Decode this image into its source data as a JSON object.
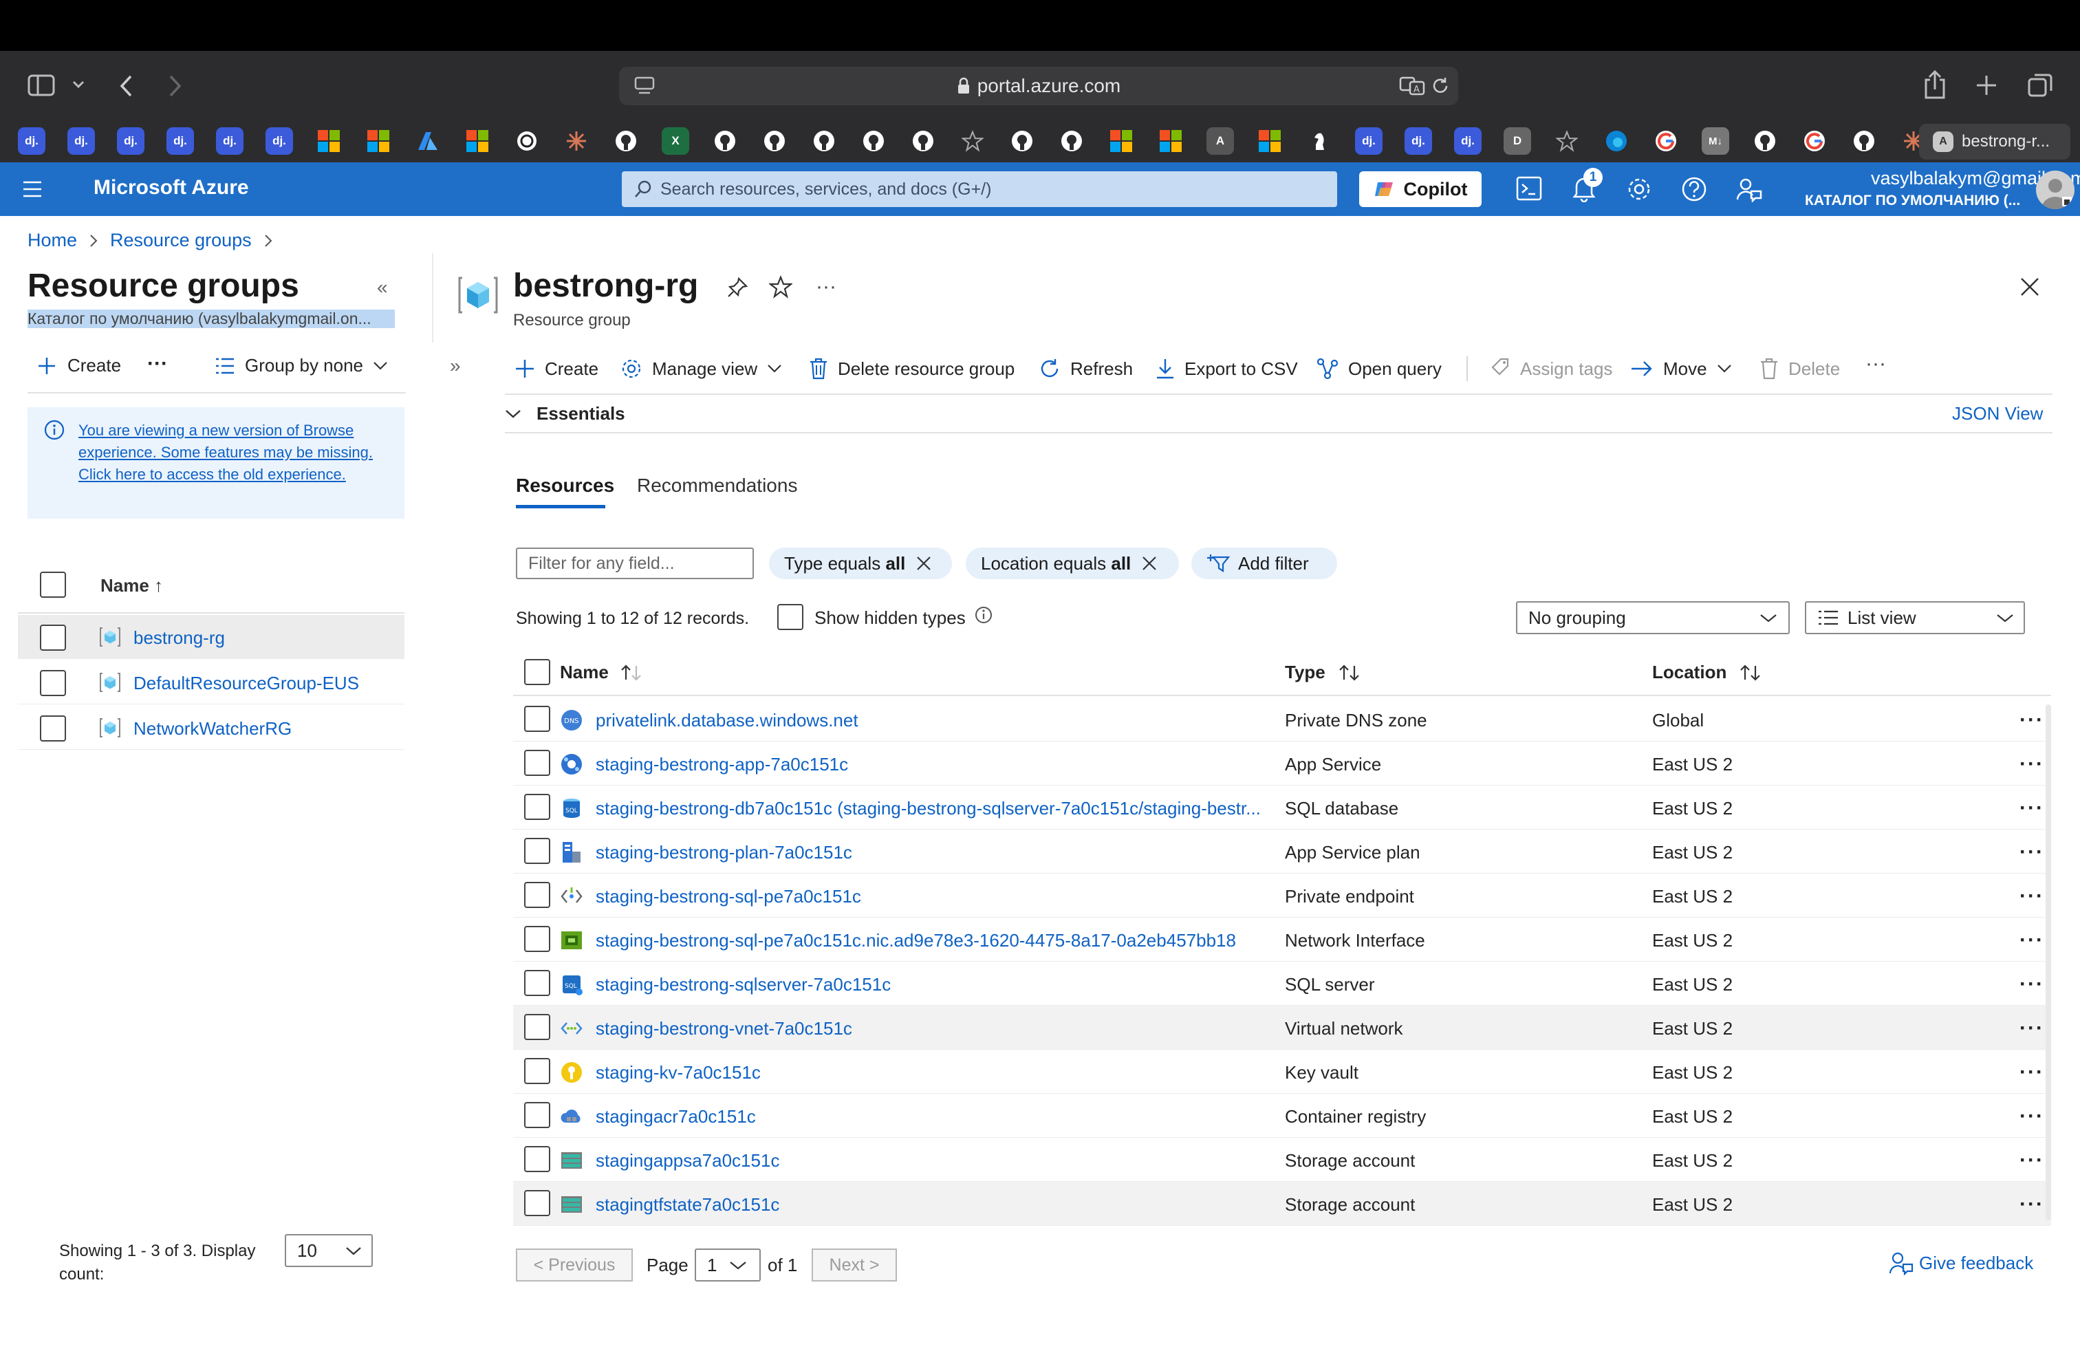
{
  "browser": {
    "url": "portal.azure.com",
    "active_tab": "bestrong-r...",
    "bookmarks": [
      "dj",
      "dj",
      "dj",
      "dj",
      "dj",
      "dj",
      "ms",
      "ms",
      "azure",
      "ms",
      "openai",
      "claude",
      "github",
      "excel",
      "github",
      "github",
      "github",
      "github",
      "github",
      "star",
      "github",
      "github",
      "ms",
      "ms",
      "A",
      "ms",
      "chess",
      "dj",
      "dj",
      "dj",
      "D",
      "star",
      "edge",
      "google",
      "md",
      "github",
      "google",
      "github",
      "claude"
    ]
  },
  "header": {
    "brand": "Microsoft Azure",
    "search_placeholder": "Search resources, services, and docs (G+/)",
    "copilot_label": "Copilot",
    "notification_count": "1",
    "user_email": "vasylbalakym@gmail.com",
    "user_directory": "КАТАЛОГ ПО УМОЛЧАНИЮ (..."
  },
  "breadcrumb": {
    "home": "Home",
    "resource_groups": "Resource groups"
  },
  "left": {
    "title": "Resource groups",
    "subtitle": "Каталог по умолчанию (vasylbalakymgmail.on...",
    "create": "Create",
    "group_by": "Group by none",
    "notice": "You are viewing a new version of Browse experience. Some features may be missing. Click here to access the old experience.",
    "col_name": "Name ↑",
    "groups": [
      "bestrong-rg",
      "DefaultResourceGroup-EUS",
      "NetworkWatcherRG"
    ],
    "showing": "Showing 1 - 3 of 3. Display count:",
    "display_count": "10"
  },
  "main": {
    "title": "bestrong-rg",
    "subtitle": "Resource group",
    "toolbar": {
      "create": "Create",
      "manage_view": "Manage view",
      "delete_rg": "Delete resource group",
      "refresh": "Refresh",
      "export": "Export to CSV",
      "open_query": "Open query",
      "assign_tags": "Assign tags",
      "move": "Move",
      "delete": "Delete"
    },
    "essentials": "Essentials",
    "json_view": "JSON View",
    "tabs": [
      "Resources",
      "Recommendations"
    ],
    "filter_placeholder": "Filter for any field...",
    "filter_type_label": "Type equals ",
    "filter_type_value": "all",
    "filter_loc_label": "Location equals ",
    "filter_loc_value": "all",
    "add_filter": "Add filter",
    "showing": "Showing 1 to 12 of 12 records.",
    "show_hidden": "Show hidden types",
    "grouping": "No grouping",
    "view_mode": "List view",
    "columns": {
      "name": "Name",
      "type": "Type",
      "location": "Location"
    },
    "resources": [
      {
        "name": "privatelink.database.windows.net",
        "type": "Private DNS zone",
        "location": "Global",
        "icon": "dns-icon"
      },
      {
        "name": "staging-bestrong-app-7a0c151c",
        "type": "App Service",
        "location": "East US 2",
        "icon": "app-service-icon"
      },
      {
        "name": "staging-bestrong-db7a0c151c (staging-bestrong-sqlserver-7a0c151c/staging-bestr...",
        "type": "SQL database",
        "location": "East US 2",
        "icon": "sql-database-icon"
      },
      {
        "name": "staging-bestrong-plan-7a0c151c",
        "type": "App Service plan",
        "location": "East US 2",
        "icon": "app-service-plan-icon"
      },
      {
        "name": "staging-bestrong-sql-pe7a0c151c",
        "type": "Private endpoint",
        "location": "East US 2",
        "icon": "private-endpoint-icon"
      },
      {
        "name": "staging-bestrong-sql-pe7a0c151c.nic.ad9e78e3-1620-4475-8a17-0a2eb457bb18",
        "type": "Network Interface",
        "location": "East US 2",
        "icon": "network-interface-icon"
      },
      {
        "name": "staging-bestrong-sqlserver-7a0c151c",
        "type": "SQL server",
        "location": "East US 2",
        "icon": "sql-server-icon"
      },
      {
        "name": "staging-bestrong-vnet-7a0c151c",
        "type": "Virtual network",
        "location": "East US 2",
        "icon": "virtual-network-icon"
      },
      {
        "name": "staging-kv-7a0c151c",
        "type": "Key vault",
        "location": "East US 2",
        "icon": "key-vault-icon"
      },
      {
        "name": "stagingacr7a0c151c",
        "type": "Container registry",
        "location": "East US 2",
        "icon": "container-registry-icon"
      },
      {
        "name": "stagingappsa7a0c151c",
        "type": "Storage account",
        "location": "East US 2",
        "icon": "storage-account-icon"
      },
      {
        "name": "stagingtfstate7a0c151c",
        "type": "Storage account",
        "location": "East US 2",
        "icon": "storage-account-icon"
      }
    ],
    "pager": {
      "previous": "< Previous",
      "page_label": "Page",
      "page": "1",
      "of": "of 1",
      "next": "Next >"
    },
    "feedback": "Give feedback"
  },
  "colors": {
    "azure_blue": "#1f6fc8",
    "link": "#0f62c4",
    "pill_bg": "#e6f0fb"
  }
}
